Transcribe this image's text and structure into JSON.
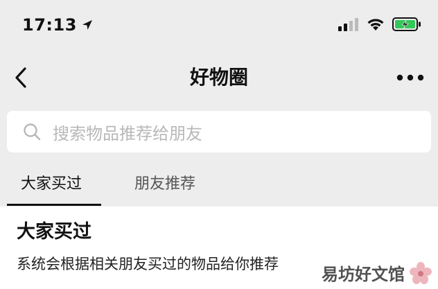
{
  "status_bar": {
    "time": "17:13"
  },
  "nav": {
    "title": "好物圈"
  },
  "search": {
    "placeholder": "搜索物品推荐给朋友"
  },
  "tabs": [
    {
      "label": "大家买过",
      "active": true
    },
    {
      "label": "朋友推荐",
      "active": false
    }
  ],
  "section": {
    "title": "大家买过",
    "description": "系统会根据相关朋友买过的物品给你推荐"
  },
  "watermark": {
    "text": "易坊好文馆"
  },
  "colors": {
    "background": "#ededed",
    "surface": "#ffffff",
    "battery_green": "#34c759",
    "placeholder": "#b8b8b8",
    "watermark_flower": "#e8a0a8"
  }
}
